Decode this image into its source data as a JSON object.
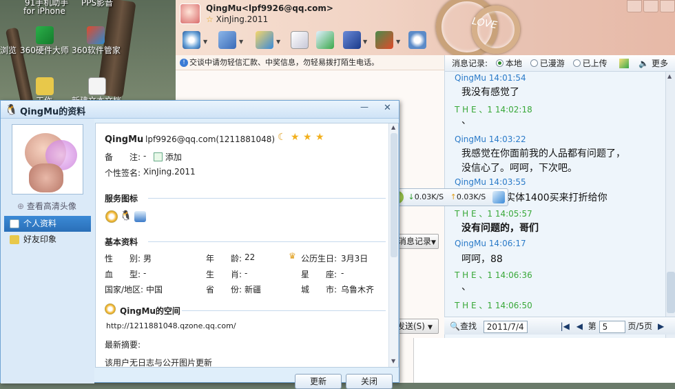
{
  "desktop": {
    "icons": [
      {
        "label": "91手机助手",
        "icon": "phone-assistant-icon"
      },
      {
        "label": "for iPhone",
        "icon": "phone-assistant-icon"
      },
      {
        "label": "PPS影音",
        "icon": "pps-icon"
      },
      {
        "label": "浏览",
        "icon": "browser-icon"
      },
      {
        "label": "360硬件大师",
        "icon": "hardware-master-icon"
      },
      {
        "label": "360软件管家",
        "icon": "software-manager-icon"
      },
      {
        "label": "工作",
        "icon": "folder-icon"
      },
      {
        "label": "新建文本文档",
        "icon": "text-file-icon"
      }
    ]
  },
  "chat": {
    "contact_name_email": "QingMu<lpf9926@qq.com>",
    "signature": "XinJing.2011",
    "warning": "交谈中请勿轻信汇款、中奖信息，勿轻易拨打陌生电话。",
    "toolbar_icons": [
      "video-call-icon",
      "voice-call-icon",
      "file-transfer-icon",
      "mail-icon",
      "app-add-icon",
      "remote-assist-icon",
      "game-icon",
      "settings-icon"
    ],
    "history": {
      "label": "消息记录:",
      "radios": [
        {
          "label": "本地",
          "selected": true
        },
        {
          "label": "已漫游",
          "selected": false
        },
        {
          "label": "已上传",
          "selected": false
        }
      ],
      "more_label": "更多",
      "messages": [
        {
          "sender": "QingMu",
          "time": "14:01:54",
          "text": "我没有感觉了",
          "color": "#2a7ac8"
        },
        {
          "sender": "T H E 、1",
          "time": "14:02:18",
          "text": "、",
          "color": "#38a838"
        },
        {
          "sender": "QingMu",
          "time": "14:03:22",
          "text": "我感觉在你面前我的人品都有问题了，",
          "text2": "没信心了。呵呵，下次吧。",
          "color": "#2a7ac8"
        },
        {
          "sender": "QingMu",
          "time": "14:03:55",
          "text": "实体1400买来打折给你",
          "color": "#2a7ac8"
        },
        {
          "sender": "T H E 、1",
          "time": "14:05:57",
          "text": "没有问题的，哥们",
          "color": "#38a838"
        },
        {
          "sender": "QingMu",
          "time": "14:06:17",
          "text": "呵呵，88",
          "color": "#2a7ac8"
        },
        {
          "sender": "T H E 、1",
          "time": "14:06:36",
          "text": "、",
          "color": "#38a838"
        },
        {
          "sender": "T H E 、1",
          "time": "14:06:50",
          "text": "",
          "color": "#38a838"
        }
      ],
      "search_label": "查找",
      "date_value": "2011/7/4",
      "page_prefix": "第",
      "page_value": "5",
      "page_suffix": "页/5页"
    },
    "history_button": "消息记录",
    "send_button": "发送(S)"
  },
  "speed": {
    "down": "0.03K/S",
    "up": "0.03K/S"
  },
  "profile": {
    "title": "QingMu的资料",
    "view_hd_avatar": "查看高清头像",
    "nav": [
      {
        "label": "个人资料",
        "selected": true
      },
      {
        "label": "好友印象",
        "selected": false
      }
    ],
    "nickname": "QingMu",
    "account": "lpf9926@qq.com(1211881048)",
    "remark_label": "备　　注:",
    "remark_value": "-",
    "add_label": "添加",
    "signature_label": "个性签名:",
    "signature_value": "XinJing.2011",
    "service_title": "服务图标",
    "basic_title": "基本资料",
    "fields": [
      {
        "label": "性　　别:",
        "value": "男"
      },
      {
        "label": "年　　龄:",
        "value": "22"
      },
      {
        "label": "公历生日:",
        "value": "3月3日"
      },
      {
        "label": "血　　型:",
        "value": "-"
      },
      {
        "label": "生　　肖:",
        "value": "-"
      },
      {
        "label": "星　　座:",
        "value": "-"
      },
      {
        "label": "国家/地区:",
        "value": "中国"
      },
      {
        "label": "省　　份:",
        "value": "新疆"
      },
      {
        "label": "城　　市:",
        "value": "乌鲁木齐"
      }
    ],
    "space_title": "QingMu的空间",
    "space_url": "http://1211881048.qzone.qq.com/",
    "summary_label": "最新摘要:",
    "summary_text": "该用户无日志与公开图片更新",
    "refresh_button": "更新",
    "close_button": "关闭",
    "colors": {
      "accent": "#2a6fb8",
      "title_bg": "#cfe3f6"
    }
  }
}
